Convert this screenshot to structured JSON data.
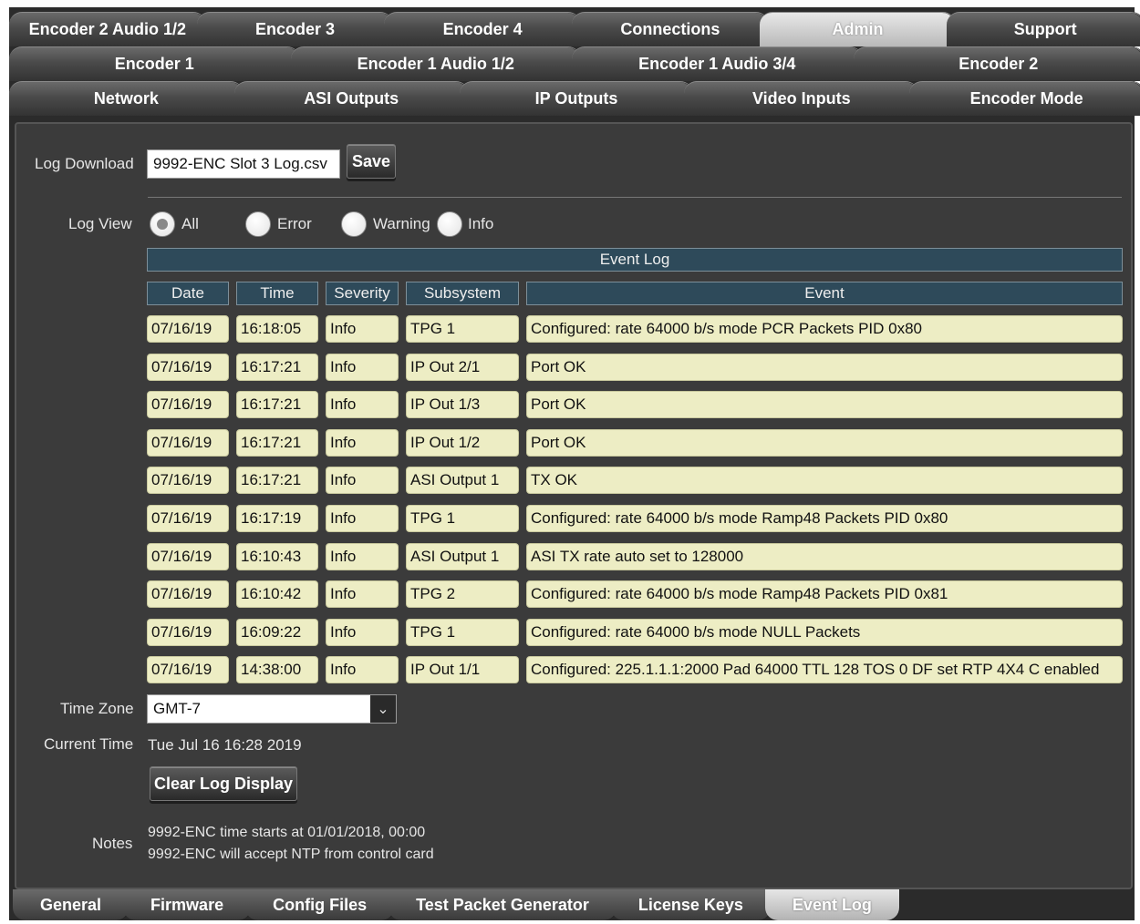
{
  "tabs_row1": [
    "Encoder 2 Audio 1/2",
    "Encoder 3",
    "Encoder 4",
    "Connections",
    "Admin",
    "Support"
  ],
  "tabs_row2": [
    "Encoder 1",
    "Encoder 1 Audio 1/2",
    "Encoder 1 Audio 3/4",
    "Encoder 2"
  ],
  "tabs_row3": [
    "Network",
    "ASI Outputs",
    "IP Outputs",
    "Video Inputs",
    "Encoder Mode"
  ],
  "active_top_tab": "Admin",
  "log_download": {
    "label": "Log Download",
    "filename": "9992-ENC Slot 3 Log.csv",
    "save_label": "Save"
  },
  "log_view": {
    "label": "Log View",
    "options": [
      "All",
      "Error",
      "Warning",
      "Info"
    ],
    "selected": "All"
  },
  "event_log": {
    "title": "Event Log",
    "columns": [
      "Date",
      "Time",
      "Severity",
      "Subsystem",
      "Event"
    ],
    "rows": [
      [
        "07/16/19",
        "16:18:05",
        "Info",
        "TPG 1",
        "Configured:  rate 64000 b/s mode PCR Packets PID 0x80"
      ],
      [
        "07/16/19",
        "16:17:21",
        "Info",
        "IP Out 2/1",
        "Port OK"
      ],
      [
        "07/16/19",
        "16:17:21",
        "Info",
        "IP Out 1/3",
        "Port OK"
      ],
      [
        "07/16/19",
        "16:17:21",
        "Info",
        "IP Out 1/2",
        "Port OK"
      ],
      [
        "07/16/19",
        "16:17:21",
        "Info",
        "ASI Output 1",
        "TX OK"
      ],
      [
        "07/16/19",
        "16:17:19",
        "Info",
        "TPG 1",
        "Configured:  rate 64000 b/s mode Ramp48 Packets PID 0x80"
      ],
      [
        "07/16/19",
        "16:10:43",
        "Info",
        "ASI Output 1",
        "ASI TX rate auto set to 128000"
      ],
      [
        "07/16/19",
        "16:10:42",
        "Info",
        "TPG 2",
        "Configured:  rate 64000 b/s mode Ramp48 Packets PID 0x81"
      ],
      [
        "07/16/19",
        "16:09:22",
        "Info",
        "TPG 1",
        "Configured:  rate 64000 b/s mode NULL Packets"
      ],
      [
        "07/16/19",
        "14:38:00",
        "Info",
        "IP Out 1/1",
        "Configured: 225.1.1.1:2000 Pad 64000 TTL 128 TOS 0 DF set RTP 4X4 C enabled"
      ]
    ]
  },
  "time_zone": {
    "label": "Time Zone",
    "value": "GMT-7"
  },
  "current_time": {
    "label": "Current Time",
    "value": "Tue Jul 16 16:28 2019"
  },
  "clear_button": "Clear Log Display",
  "notes": {
    "label": "Notes",
    "lines": [
      "9992-ENC time starts at 01/01/2018, 00:00",
      "9992-ENC will accept NTP from control card"
    ]
  },
  "bottom_tabs": [
    "General",
    "Firmware",
    "Config Files",
    "Test Packet Generator",
    "License Keys",
    "Event Log"
  ],
  "active_bottom_tab": "Event Log"
}
